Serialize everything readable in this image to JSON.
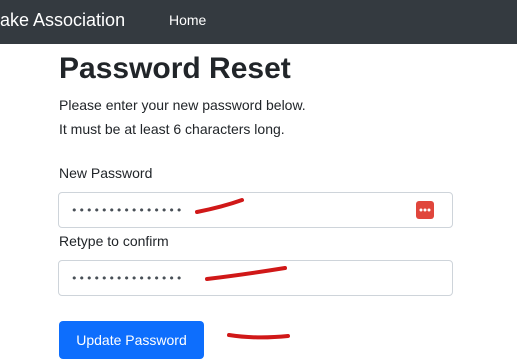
{
  "navbar": {
    "brand": "ake Association",
    "home_link": "Home"
  },
  "page": {
    "title": "Password Reset",
    "intro_line1": "Please enter your new password below.",
    "intro_line2": "It must be at least 6 characters long."
  },
  "form": {
    "new_password_label": "New Password",
    "new_password_value": "•••••••••••••••",
    "confirm_label": "Retype to confirm",
    "confirm_value": "•••••••••••••••",
    "submit_label": "Update Password"
  },
  "icons": {
    "password_manager": "password-manager-icon"
  },
  "colors": {
    "navbar": "#343a40",
    "primary": "#0d6efd",
    "icon_red": "#e0463c",
    "annotation": "#d01818"
  }
}
